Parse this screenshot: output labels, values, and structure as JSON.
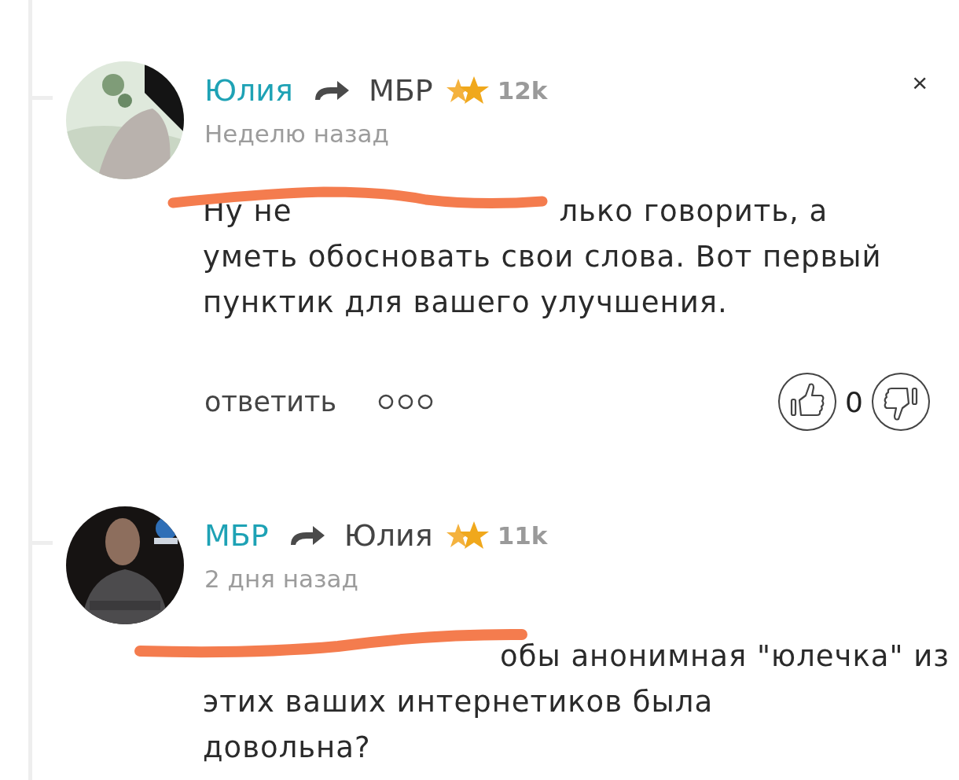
{
  "comments": [
    {
      "author": "Юлия",
      "reply_to": "МБР",
      "rating": "12k",
      "time": "Неделю назад",
      "avatar": {
        "kind": "picture"
      },
      "close": "×",
      "lines": [
        [
          {
            "kind": "text",
            "text": "Ну не"
          },
          {
            "kind": "covered"
          },
          {
            "kind": "text",
            "text": "лько говорить, а"
          }
        ],
        [
          {
            "kind": "text",
            "text": "уметь обосновать свои слова. Вот первый"
          }
        ],
        [
          {
            "kind": "text",
            "text": "пунктик для вашего улучшения."
          }
        ]
      ],
      "scribbled": true,
      "actions": {
        "reply": "ответить",
        "votes": "0"
      }
    },
    {
      "author": "МБР",
      "reply_to": "Юлия",
      "rating": "11k",
      "time": "2 дня назад",
      "avatar": {
        "kind": "picture"
      },
      "lines": [
        [
          {
            "kind": "covered"
          },
          {
            "kind": "text",
            "text": "обы анонимная \"юлечка\" из"
          }
        ],
        [
          {
            "kind": "text",
            "text": "этих ваших интернетиков была"
          }
        ],
        [
          {
            "kind": "text",
            "text": "довольна?"
          }
        ]
      ],
      "scribbled": true
    }
  ]
}
